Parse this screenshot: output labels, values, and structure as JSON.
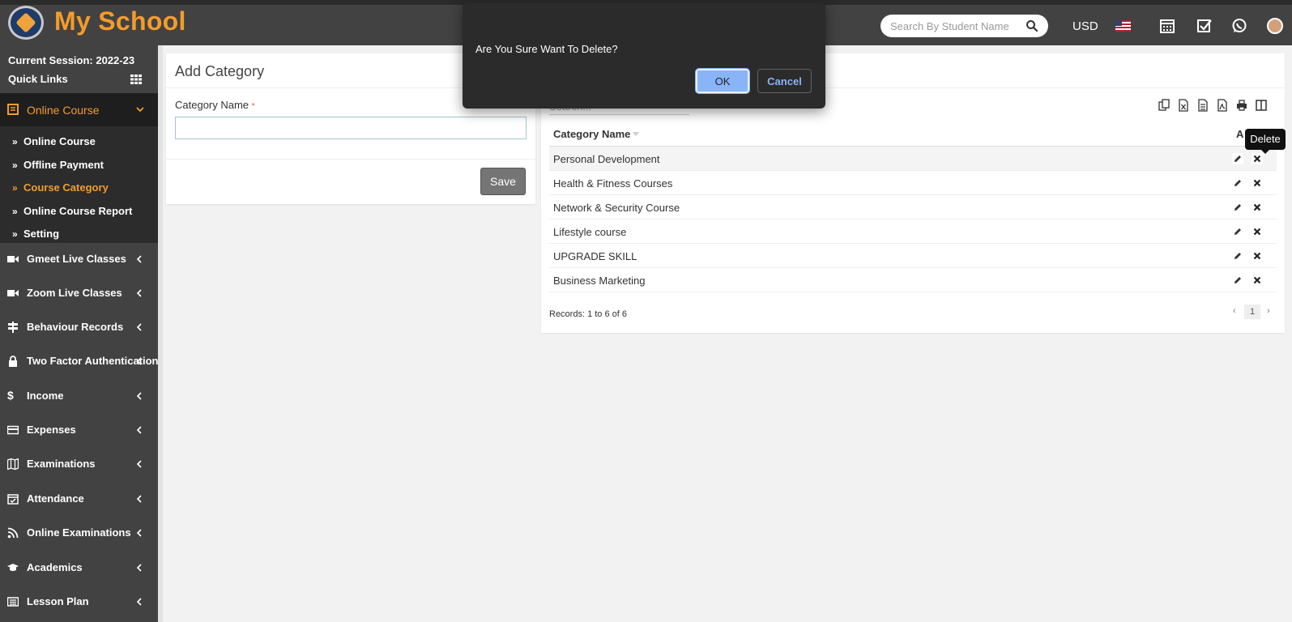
{
  "header": {
    "brand": "My School",
    "search_placeholder": "Search By Student Name",
    "currency": "USD"
  },
  "sidebar": {
    "session": "Current Session: 2022-23",
    "quick_links": "Quick Links",
    "active_menu": "Online Course",
    "submenu": [
      {
        "label": "Online Course"
      },
      {
        "label": "Offline Payment"
      },
      {
        "label": "Course Category"
      },
      {
        "label": "Online Course Report"
      },
      {
        "label": "Setting"
      }
    ],
    "menu": [
      {
        "label": "Gmeet Live Classes"
      },
      {
        "label": "Zoom Live Classes"
      },
      {
        "label": "Behaviour Records"
      },
      {
        "label": "Two Factor Authentication"
      },
      {
        "label": "Income"
      },
      {
        "label": "Expenses"
      },
      {
        "label": "Examinations"
      },
      {
        "label": "Attendance"
      },
      {
        "label": "Online Examinations"
      },
      {
        "label": "Academics"
      },
      {
        "label": "Lesson Plan"
      }
    ]
  },
  "add_category": {
    "title": "Add Category",
    "field_label": "Category Name",
    "required_mark": "*",
    "value": "",
    "save_label": "Save"
  },
  "list": {
    "search_placeholder": "Search...",
    "col_name": "Category Name",
    "col_action": "A",
    "rows": [
      {
        "name": "Personal Development"
      },
      {
        "name": "Health & Fitness Courses"
      },
      {
        "name": "Network & Security Course"
      },
      {
        "name": "Lifestyle course"
      },
      {
        "name": "UPGRADE SKILL"
      },
      {
        "name": "Business Marketing"
      }
    ],
    "records": "Records: 1 to 6 of 6",
    "page_prev": "‹",
    "page": "1",
    "page_next": "›",
    "tooltip": "Delete"
  },
  "dialog": {
    "message": "Are You Sure Want To Delete?",
    "ok_label": "OK",
    "cancel_label": "Cancel"
  },
  "colors": {
    "accent": "#f39c2c",
    "header_bg": "#424242",
    "sidebar_active_bg": "#1e1e1e",
    "dialog_bg": "#2b2b2b",
    "ok_button": "#8ab4f8"
  }
}
